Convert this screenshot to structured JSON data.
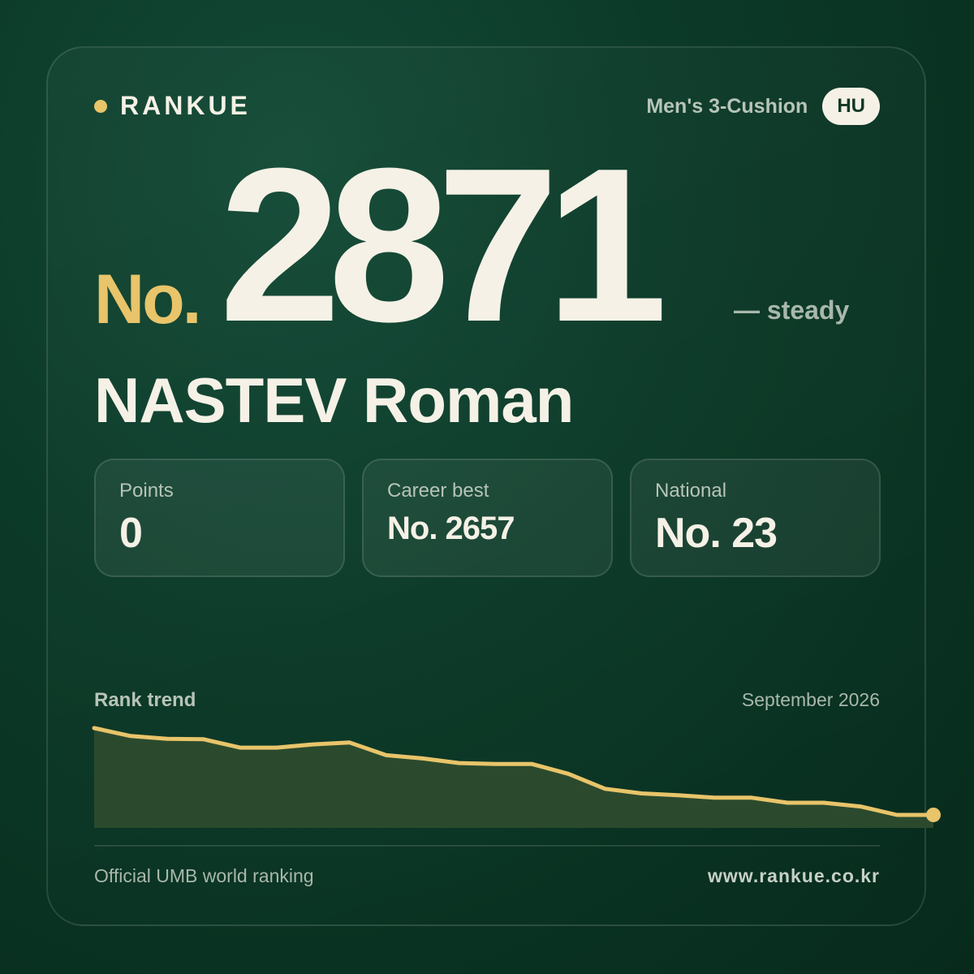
{
  "brand": {
    "name": "RANKUE",
    "dot_color": "#e8c46a"
  },
  "header": {
    "discipline": "Men's 3-Cushion",
    "country_code": "HU"
  },
  "rank": {
    "prefix": "No.",
    "number": "2871",
    "change": "— steady"
  },
  "player": {
    "name": "NASTEV Roman"
  },
  "stats": [
    {
      "label": "Points",
      "value": "0"
    },
    {
      "label": "Career best",
      "value": "No. 2657"
    },
    {
      "label": "National",
      "value": "No. 23"
    }
  ],
  "trend": {
    "label": "Rank trend",
    "date": "September 2026",
    "line_color": "#e8c46a",
    "fill_color": "#2b4a2d"
  },
  "chart_data": {
    "type": "area",
    "values": [
      0,
      0.085,
      0.115,
      0.12,
      0.21,
      0.21,
      0.175,
      0.155,
      0.29,
      0.325,
      0.375,
      0.385,
      0.385,
      0.49,
      0.65,
      0.7,
      0.72,
      0.745,
      0.745,
      0.8,
      0.8,
      0.84,
      0.93,
      0.93
    ],
    "values_note_free": true
  },
  "footer": {
    "source": "Official UMB world ranking",
    "url": "www.rankue.co.kr"
  }
}
